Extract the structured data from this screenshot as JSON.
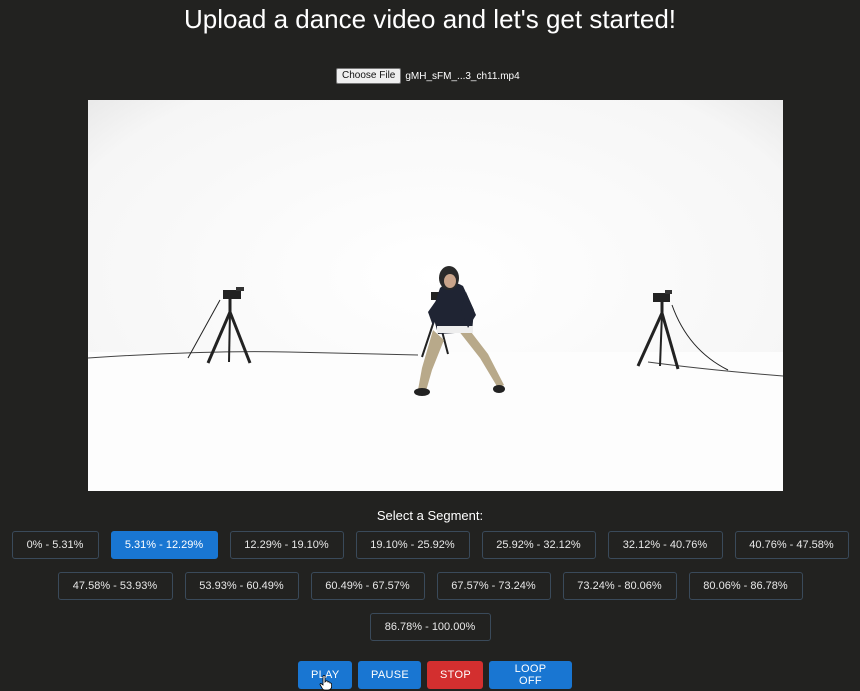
{
  "page": {
    "title": "Upload a dance video and let's get started!"
  },
  "file_input": {
    "button_label": "Choose File",
    "file_name": "gMH_sFM_...3_ch11.mp4"
  },
  "segments": {
    "label": "Select a Segment:",
    "rows": [
      [
        "0% - 5.31%",
        "5.31% - 12.29%",
        "12.29% - 19.10%",
        "19.10% - 25.92%",
        "25.92% - 32.12%",
        "32.12% - 40.76%",
        "40.76% - 47.58%"
      ],
      [
        "47.58% - 53.93%",
        "53.93% - 60.49%",
        "60.49% - 67.57%",
        "67.57% - 73.24%",
        "73.24% - 80.06%",
        "80.06% - 86.78%"
      ],
      [
        "86.78% - 100.00%"
      ]
    ],
    "selected": "5.31% - 12.29%"
  },
  "controls": {
    "play": "PLAY",
    "pause": "PAUSE",
    "stop": "STOP",
    "loop": "LOOP OFF"
  },
  "colors": {
    "background": "#222220",
    "primary": "#1976d2",
    "danger": "#d32f2f"
  }
}
